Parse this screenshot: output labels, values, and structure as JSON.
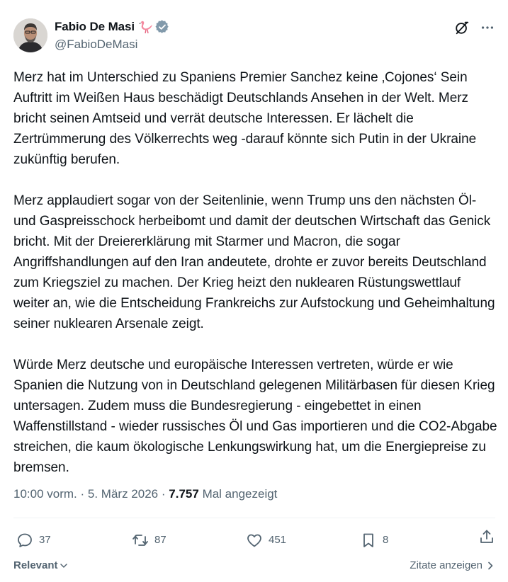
{
  "author": {
    "display_name": "Fabio De Masi",
    "handle": "@FabioDeMasi",
    "emoji_icon": "flamingo-icon",
    "verified_color": "#829aab"
  },
  "tweet": {
    "paragraphs": [
      "Merz hat im Unterschied zu Spaniens Premier Sanchez keine ‚Cojones‘ Sein Auftritt im Weißen Haus beschädigt Deutschlands Ansehen in der Welt. Merz bricht seinen Amtseid und verrät deutsche Interessen. Er lächelt die Zertrümmerung des Völkerrechts weg -darauf könnte sich Putin in der Ukraine zukünftig berufen.",
      "Merz applaudiert sogar von der Seitenlinie, wenn Trump uns den nächsten Öl- und Gaspreisschock herbeibomt und damit der deutschen Wirtschaft das Genick bricht. Mit der Dreiererklärung mit Starmer und Macron, die sogar Angriffshandlungen auf den Iran andeutete, drohte er zuvor bereits Deutschland zum Kriegsziel zu machen. Der Krieg heizt den nuklearen Rüstungswettlauf weiter an, wie die Entscheidung Frankreichs zur Aufstockung und Geheimhaltung seiner nuklearen Arsenale zeigt.",
      "Würde Merz deutsche und europäische Interessen vertreten, würde er wie Spanien die Nutzung von in Deutschland gelegenen Militärbasen für diesen Krieg untersagen. Zudem muss die Bundesregierung - eingebettet in einen Waffenstillstand - wieder russisches Öl und Gas importieren und die CO2-Abgabe streichen, die kaum ökologische Lenkungswirkung hat, um die Energiepreise zu bremsen."
    ],
    "time": "10:00 vorm.",
    "date": "5. März 2026",
    "separator": "·",
    "views_count": "7.757",
    "views_label": "Mal angezeigt"
  },
  "actions": {
    "replies": "37",
    "reposts": "87",
    "likes": "451",
    "bookmarks": "8"
  },
  "footer": {
    "sort_label": "Relevant",
    "quotes_label": "Zitate anzeigen"
  },
  "colors": {
    "text": "#0f1419",
    "secondary": "#536471",
    "divider": "#eff3f4"
  }
}
